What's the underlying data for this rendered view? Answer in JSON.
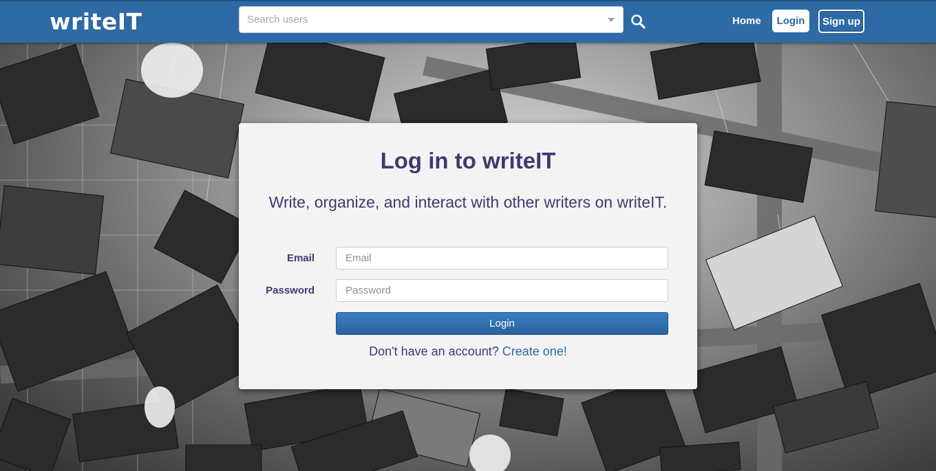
{
  "header": {
    "logo": "writeIT",
    "search": {
      "placeholder": "Search users",
      "value": ""
    },
    "nav": {
      "home": "Home",
      "login": "Login",
      "signup": "Sign up"
    }
  },
  "login_card": {
    "title": "Log in to writeIT",
    "subtitle": "Write, organize, and interact with other writers on writeIT.",
    "email_label": "Email",
    "email_placeholder": "Email",
    "email_value": "",
    "password_label": "Password",
    "password_placeholder": "Password",
    "password_value": "",
    "submit_label": "Login",
    "signup_prompt": "Don't have an account?",
    "signup_link": "Create one!"
  },
  "colors": {
    "header": "#2d6aa6",
    "title_text": "#3d3b6e",
    "link": "#2d6aa6",
    "card_bg": "#f3f3f4"
  },
  "background": {
    "icon": "hanging-books-photo"
  }
}
